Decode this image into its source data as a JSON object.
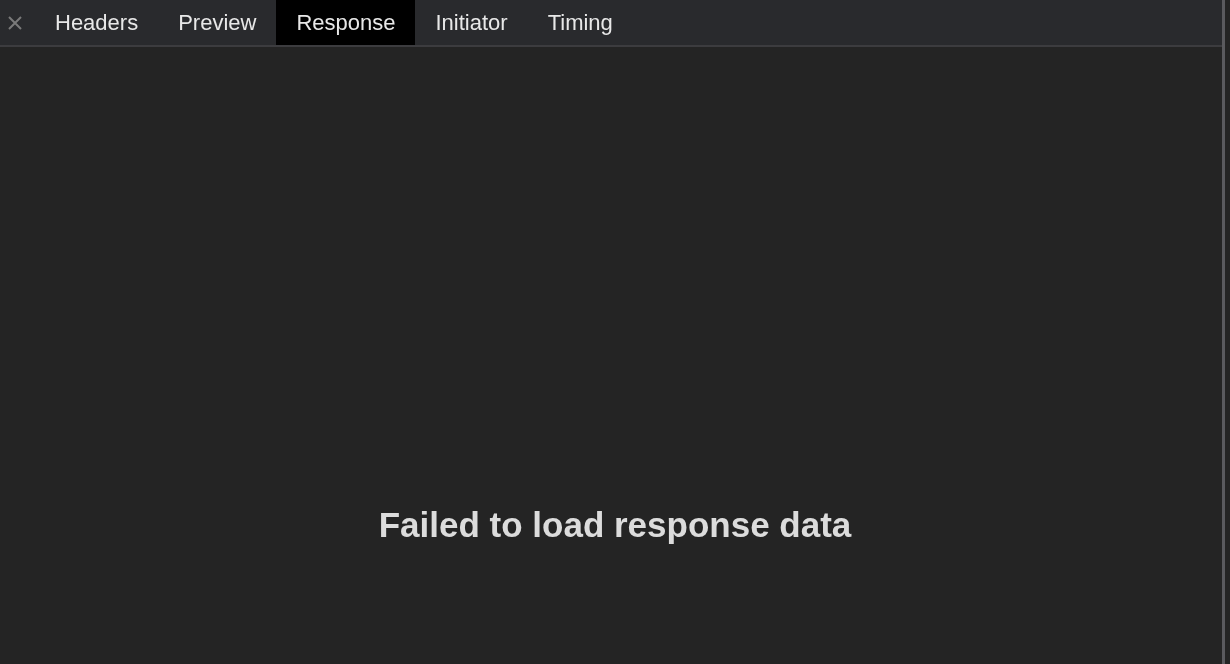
{
  "tabs": [
    {
      "label": "Headers",
      "selected": false
    },
    {
      "label": "Preview",
      "selected": false
    },
    {
      "label": "Response",
      "selected": true
    },
    {
      "label": "Initiator",
      "selected": false
    },
    {
      "label": "Timing",
      "selected": false
    }
  ],
  "message": "Failed to load response data"
}
